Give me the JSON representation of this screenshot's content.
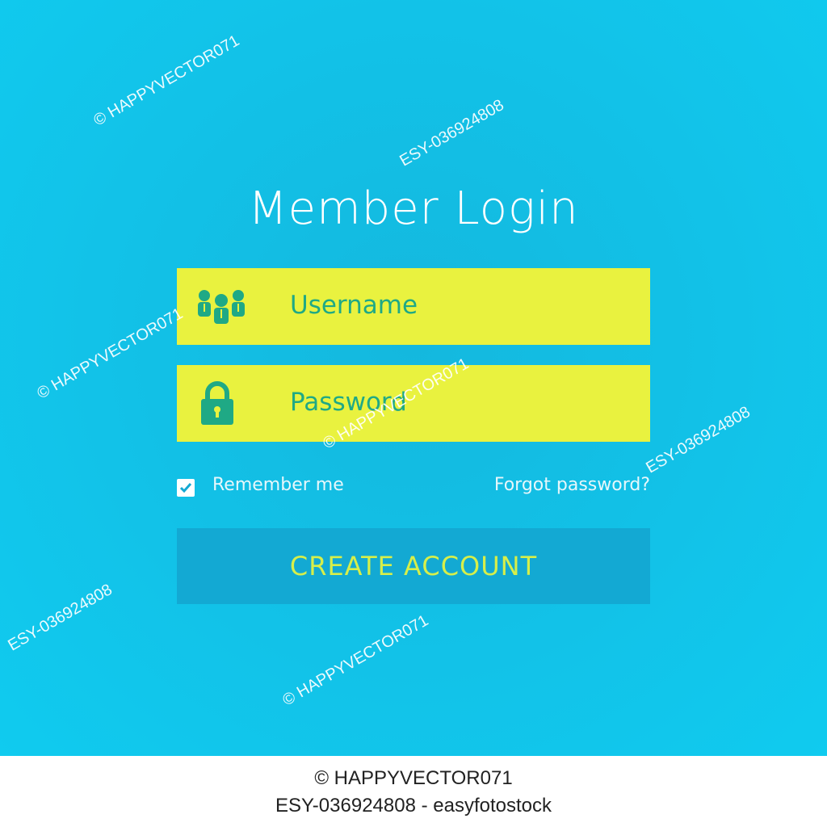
{
  "login": {
    "title": "Member Login",
    "username_placeholder": "Username",
    "password_placeholder": "Password",
    "remember_label": "Remember me",
    "remember_checked": true,
    "forgot_label": "Forgot password?",
    "create_label": "CREATE ACCOUNT"
  },
  "icons": {
    "username": "users-group-icon",
    "password": "padlock-icon",
    "remember": "checkmark-icon"
  },
  "colors": {
    "background": "#12c2e8",
    "field": "#e9f23f",
    "field_text": "#1fa985",
    "button": "#13a9d3",
    "button_text": "#d6ef4a"
  },
  "watermarks": {
    "author": "© HAPPYVECTOR071",
    "id": "ESY-036924808"
  },
  "footer": {
    "line1": "© HAPPYVECTOR071",
    "line2": "ESY-036924808 - easyfotostock"
  }
}
